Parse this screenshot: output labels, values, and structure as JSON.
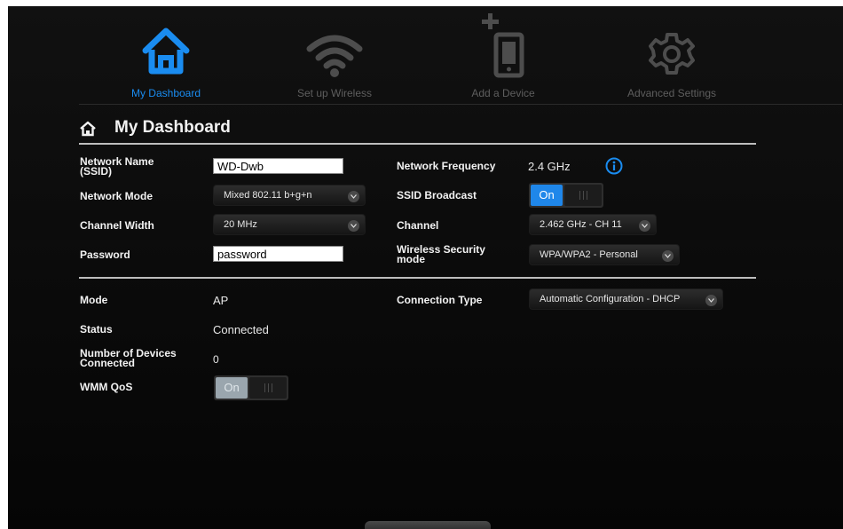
{
  "nav": {
    "items": [
      {
        "label": "My Dashboard",
        "icon": "home-icon",
        "active": true
      },
      {
        "label": "Set up Wireless",
        "icon": "wifi-icon",
        "active": false
      },
      {
        "label": "Add a Device",
        "icon": "add-device-icon",
        "active": false
      },
      {
        "label": "Advanced Settings",
        "icon": "gear-icon",
        "active": false
      }
    ]
  },
  "page": {
    "title": "My Dashboard",
    "title_icon": "home-outline-icon"
  },
  "wireless": {
    "ssid_label": "Network Name (SSID)",
    "ssid_value": "WD-Dwb",
    "mode_label": "Network Mode",
    "mode_value": "Mixed 802.11 b+g+n",
    "width_label": "Channel Width",
    "width_value": "20 MHz",
    "password_label": "Password",
    "password_value": "password",
    "freq_label": "Network Frequency",
    "freq_value": "2.4 GHz",
    "broadcast_label": "SSID Broadcast",
    "broadcast_state": "On",
    "channel_label": "Channel",
    "channel_value": "2.462 GHz - CH 11",
    "security_label": "Wireless Security mode",
    "security_value": "WPA/WPA2 - Personal"
  },
  "status": {
    "mode_label": "Mode",
    "mode_value": "AP",
    "status_label": "Status",
    "status_value": "Connected",
    "devices_label": "Number of Devices Connected",
    "devices_value": "0",
    "wmm_label": "WMM QoS",
    "wmm_state": "On",
    "conn_label": "Connection Type",
    "conn_value": "Automatic Configuration - DHCP"
  },
  "colors": {
    "accent": "#1a8cf0",
    "background": "#000000",
    "toggle_on": "#1f87ea"
  }
}
